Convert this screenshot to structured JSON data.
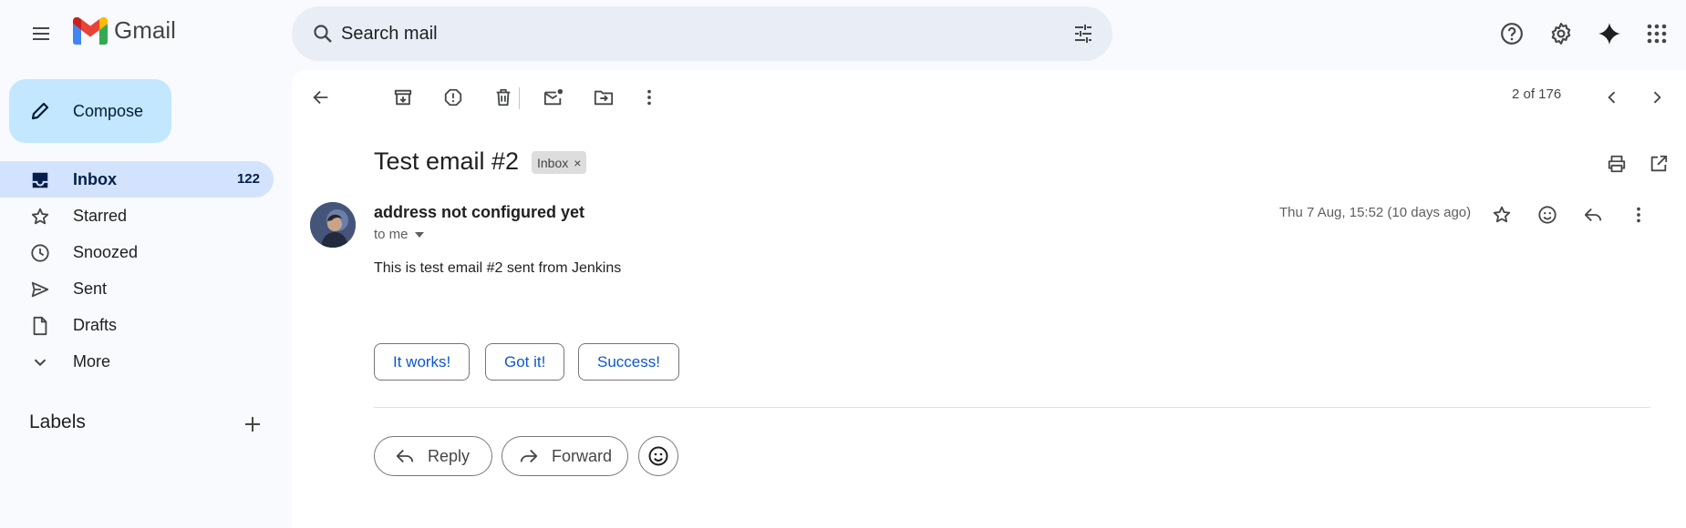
{
  "app": {
    "name": "Gmail",
    "brand_colors": {
      "red": "#ea4335",
      "blue": "#4285f4",
      "green": "#34a853",
      "yellow": "#fbbc04"
    }
  },
  "search": {
    "placeholder": "Search mail"
  },
  "header_icons": [
    "help-icon",
    "gear-icon",
    "gemini-icon",
    "apps-icon"
  ],
  "sidebar": {
    "compose_label": "Compose",
    "items": [
      {
        "label": "Inbox",
        "count": "122",
        "icon": "inbox-icon",
        "active": true
      },
      {
        "label": "Starred",
        "icon": "star-icon"
      },
      {
        "label": "Snoozed",
        "icon": "clock-icon"
      },
      {
        "label": "Sent",
        "icon": "send-icon"
      },
      {
        "label": "Drafts",
        "icon": "draft-icon"
      },
      {
        "label": "More",
        "icon": "chevron-down-icon"
      }
    ],
    "labels_title": "Labels"
  },
  "toolbar": {
    "pager": "2 of 176",
    "icons": [
      "back-arrow-icon",
      "archive-icon",
      "report-spam-icon",
      "delete-icon",
      "mark-unread-icon",
      "move-to-icon",
      "more-vert-icon",
      "prev-icon",
      "next-icon"
    ]
  },
  "email": {
    "subject": "Test email #2",
    "label_chip": "Inbox",
    "label_chip_remove": "×",
    "sender": "address not configured yet",
    "recipient": "to me",
    "date": "Thu 7 Aug, 15:52 (10 days ago)",
    "body": "This is test email #2 sent from Jenkins"
  },
  "smart_replies": [
    "It works!",
    "Got it!",
    "Success!"
  ],
  "actions": {
    "reply": "Reply",
    "forward": "Forward"
  },
  "colors": {
    "accent": "#0b57d0",
    "compose_bg": "#c2e7ff",
    "active_nav_bg": "#d3e3fd",
    "page_bg": "#f8fafd"
  }
}
